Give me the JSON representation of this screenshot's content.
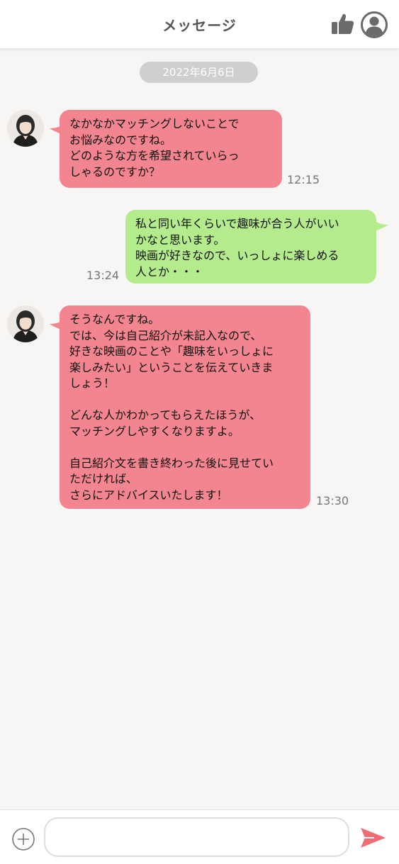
{
  "header": {
    "title": "メッセージ",
    "icons": {
      "like": "thumbs-up-icon",
      "profile": "user-circle-icon"
    }
  },
  "date_separator": "2022年6月6日",
  "messages": [
    {
      "direction": "incoming",
      "text": "なかなかマッチングしないことで\nお悩みなのですね。\nどのような方を希望されていらっ\nしゃるのですか？",
      "time": "12:15"
    },
    {
      "direction": "outgoing",
      "text": "私と同い年くらいで趣味が合う人がいい\nかなと思います。\n映画が好きなので、いっしょに楽しめる\n人とか・・・",
      "time": "13:24"
    },
    {
      "direction": "incoming",
      "text": "そうなんですね。\nでは、今は自己紹介が未記入なので、\n好きな映画のことや「趣味をいっしょに\n楽しみたい」ということを伝えていきま\nしょう！\n\nどんな人かわかってもらえたほうが、\nマッチングしやすくなりますよ。\n\n自己紹介文を書き終わった後に見せてい\nただければ、\nさらにアドバイスいたします！",
      "time": "13:30"
    }
  ],
  "composer": {
    "placeholder": "",
    "value": "",
    "icons": {
      "add": "plus-circle-icon",
      "send": "send-icon"
    }
  },
  "colors": {
    "incoming_bubble": "#f2858f",
    "outgoing_bubble": "#b4eb8c",
    "date_pill": "#cfcfcf",
    "send_accent": "#f06b74",
    "background": "#f8f6f4"
  }
}
